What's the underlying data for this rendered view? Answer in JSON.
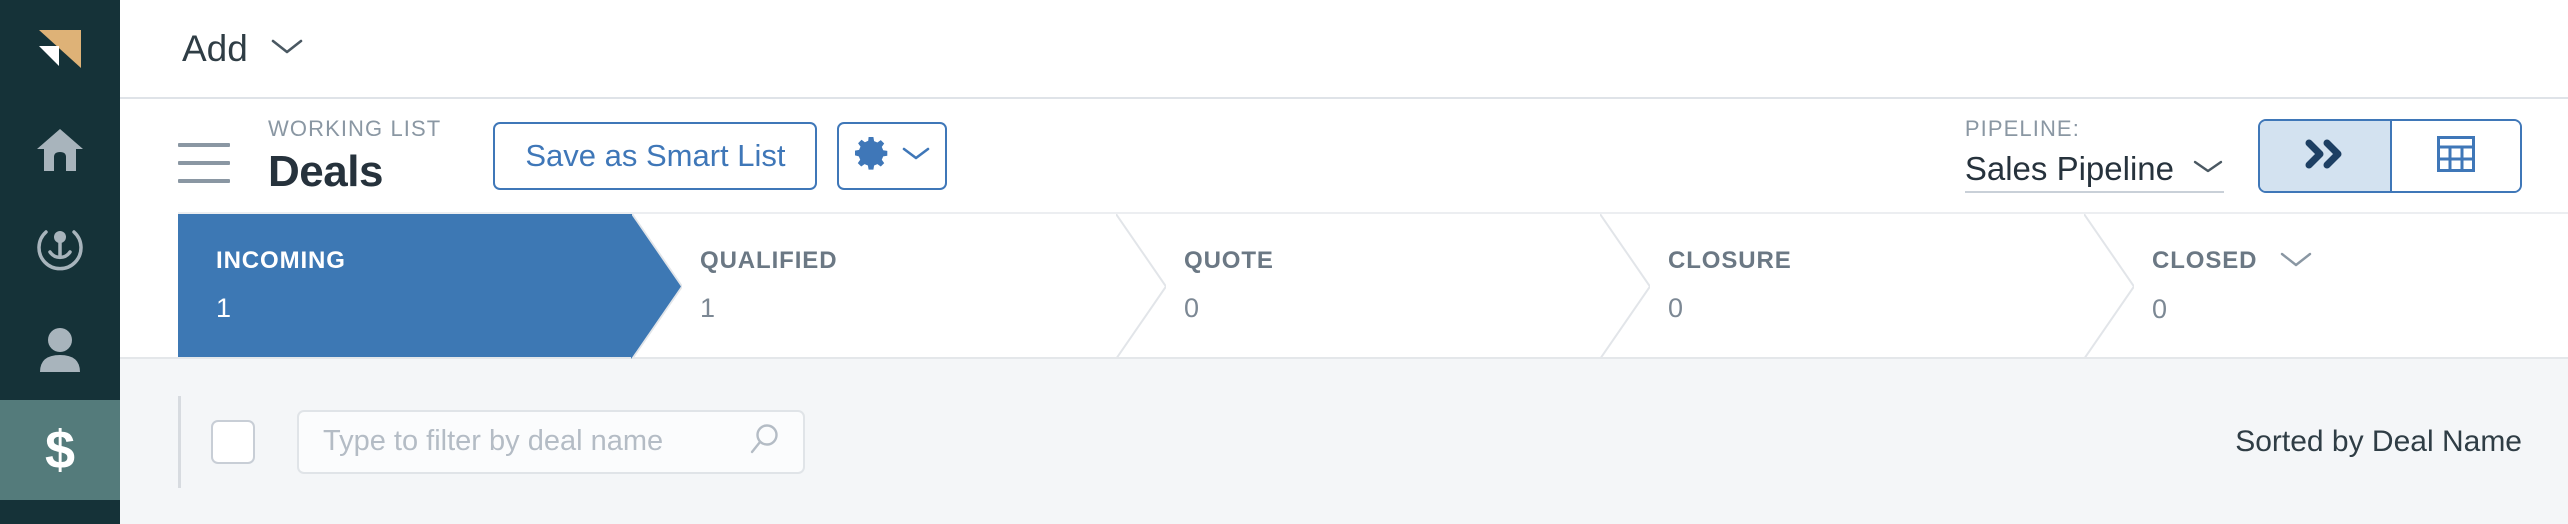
{
  "sidebar": {
    "logo_icon": "triangle-logo-icon",
    "items": [
      {
        "icon": "home-icon",
        "name": "home",
        "active": false
      },
      {
        "icon": "target-icon",
        "name": "activity",
        "active": false
      },
      {
        "icon": "person-icon",
        "name": "contacts",
        "active": false
      },
      {
        "icon": "dollar-icon",
        "name": "deals",
        "active": true
      }
    ]
  },
  "topbar": {
    "add_label": "Add",
    "add_chevron_icon": "chevron-down-icon"
  },
  "toolbar": {
    "menu_icon": "hamburger-menu-icon",
    "kicker": "WORKING LIST",
    "title": "Deals",
    "save_smart_list_label": "Save as Smart List",
    "gear_icon": "gear-icon",
    "gear_chevron_icon": "chevron-down-icon",
    "pipeline_label": "PIPELINE:",
    "pipeline_value": "Sales Pipeline",
    "pipeline_chevron_icon": "chevron-down-icon",
    "view_toggle": [
      {
        "icon": "double-chevron-right-icon",
        "name": "pipeline-view",
        "active": true
      },
      {
        "icon": "table-grid-icon",
        "name": "table-view",
        "active": false
      }
    ]
  },
  "stages": [
    {
      "name": "INCOMING",
      "count": "1",
      "active": true,
      "has_chevron": false
    },
    {
      "name": "QUALIFIED",
      "count": "1",
      "active": false,
      "has_chevron": false
    },
    {
      "name": "QUOTE",
      "count": "0",
      "active": false,
      "has_chevron": false
    },
    {
      "name": "CLOSURE",
      "count": "0",
      "active": false,
      "has_chevron": false
    },
    {
      "name": "CLOSED",
      "count": "0",
      "active": false,
      "has_chevron": true
    }
  ],
  "filterbar": {
    "select_all_checkbox": "",
    "search_placeholder": "Type to filter by deal name",
    "search_value": "",
    "search_icon": "search-icon",
    "sorted_by": "Sorted by Deal Name"
  },
  "colors": {
    "rail_bg": "#153238",
    "rail_active": "#547b7b",
    "accent_blue": "#3f77b8",
    "stage_active": "#3d78b4",
    "filter_bg": "#f4f6f8",
    "text_dark": "#26323c",
    "text_muted": "#8a97a3",
    "logo_gold": "#deb277"
  }
}
